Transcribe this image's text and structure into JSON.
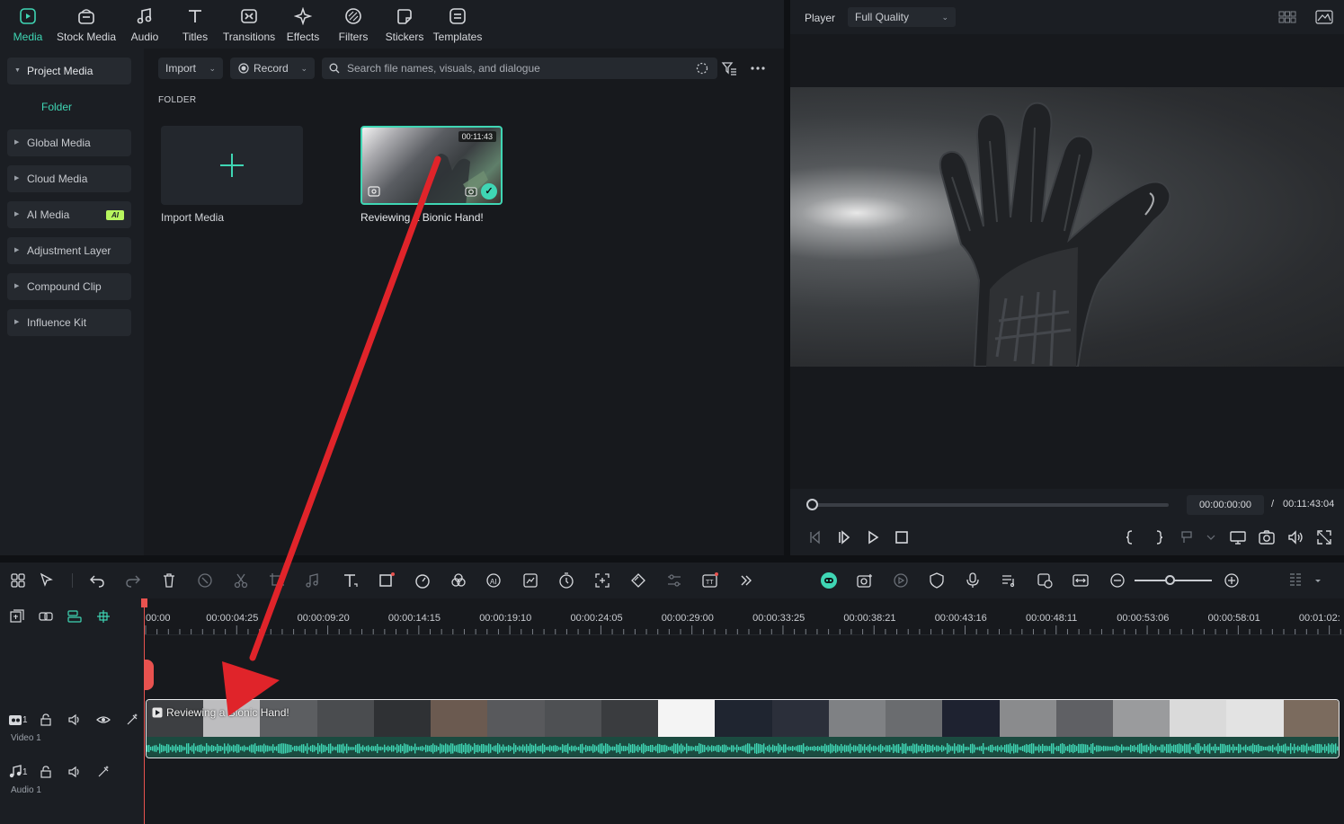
{
  "toolbar": {
    "items": [
      {
        "label": "Media",
        "icon": "media-icon",
        "active": true
      },
      {
        "label": "Stock Media",
        "icon": "stock-media-icon"
      },
      {
        "label": "Audio",
        "icon": "music-note-icon"
      },
      {
        "label": "Titles",
        "icon": "text-t-icon"
      },
      {
        "label": "Transitions",
        "icon": "transitions-icon"
      },
      {
        "label": "Effects",
        "icon": "effects-sparkle-icon"
      },
      {
        "label": "Filters",
        "icon": "filters-icon"
      },
      {
        "label": "Stickers",
        "icon": "sticker-icon"
      },
      {
        "label": "Templates",
        "icon": "templates-icon"
      }
    ],
    "accent_color": "#3fd6b4"
  },
  "sidebar": {
    "items": [
      {
        "label": "Project Media",
        "expanded": true
      },
      {
        "label": "Global Media"
      },
      {
        "label": "Cloud Media"
      },
      {
        "label": "AI Media",
        "badge": "AI"
      },
      {
        "label": "Adjustment Layer"
      },
      {
        "label": "Compound Clip"
      },
      {
        "label": "Influence Kit"
      }
    ],
    "folder_label": "Folder"
  },
  "media": {
    "import_button": "Import",
    "record_button": "Record",
    "search_placeholder": "Search file names, visuals, and dialogue",
    "folder_heading": "FOLDER",
    "import_tile_label": "Import Media",
    "clip": {
      "name": "Reviewing a Bionic Hand!",
      "duration": "00:11:43",
      "selected": true
    }
  },
  "player": {
    "title": "Player",
    "quality": "Full Quality",
    "current_time": "00:00:00:00",
    "separator": "/",
    "total_time": "00:11:43:04",
    "progress": 0
  },
  "timeline": {
    "ruler_labels": [
      "00:00",
      "00:00:04:25",
      "00:00:09:20",
      "00:00:14:15",
      "00:00:19:10",
      "00:00:24:05",
      "00:00:29:00",
      "00:00:33:25",
      "00:00:38:21",
      "00:00:43:16",
      "00:00:48:11",
      "00:00:53:06",
      "00:00:58:01",
      "00:01:02:"
    ],
    "video_track_label": "Video 1",
    "audio_track_label": "Audio 1",
    "video_track_number": "1",
    "audio_track_number": "1",
    "clip_name": "Reviewing a Bionic Hand!",
    "zoom_level": 0.4,
    "playhead_color": "#e8524f",
    "audio_wave_color": "#3fd6b4"
  },
  "annotation": {
    "arrow_color": "#e0242a"
  }
}
